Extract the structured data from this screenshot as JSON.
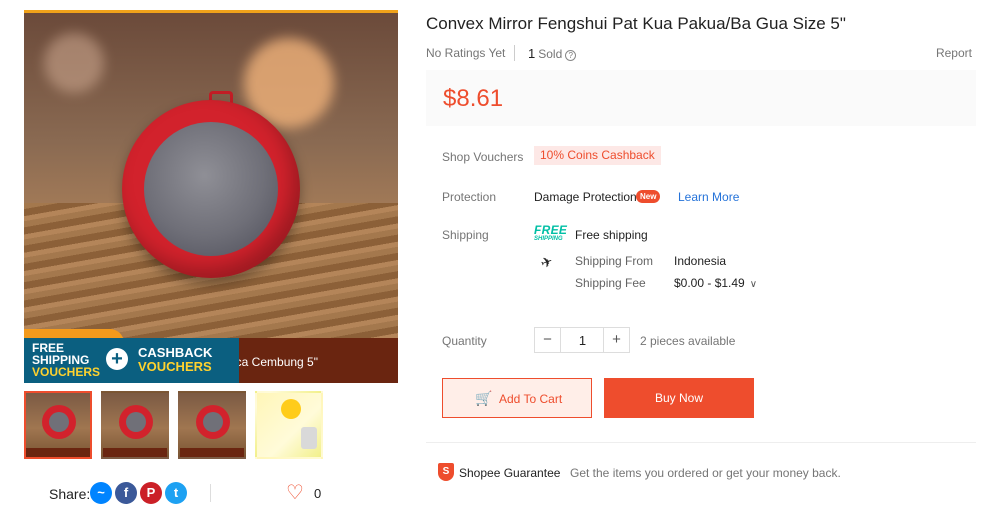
{
  "gallery": {
    "main_caption": "aca Cembung 5\"",
    "voucher": {
      "line1": "FREE",
      "line2": "SHIPPING",
      "line3": "VOUCHERS",
      "plus": "+",
      "line4": "CASHBACK",
      "line5": "VOUCHERS"
    },
    "thumbnail_count": 4
  },
  "share": {
    "label": "Share:",
    "icons": [
      "messenger-icon",
      "facebook-icon",
      "pinterest-icon",
      "twitter-icon"
    ],
    "like_count": "0"
  },
  "product": {
    "title": "Convex Mirror Fengshui Pat Kua Pakua/Ba Gua Size 5\"",
    "ratings": "No Ratings Yet",
    "sold_count": "1",
    "sold_label": "Sold",
    "report": "Report",
    "price": "$8.61"
  },
  "details": {
    "vouchers_label": "Shop Vouchers",
    "vouchers_value": "10% Coins Cashback",
    "protection_label": "Protection",
    "protection_value": "Damage Protection",
    "new_badge": "New",
    "learn_more": "Learn More",
    "shipping_label": "Shipping",
    "free_logo_top": "FREE",
    "free_logo_bottom": "SHIPPING",
    "free_shipping": "Free shipping",
    "ship_from_label": "Shipping From",
    "ship_from_value": "Indonesia",
    "ship_fee_label": "Shipping Fee",
    "ship_fee_value": "$0.00 - $1.49"
  },
  "quantity": {
    "label": "Quantity",
    "minus": "−",
    "value": "1",
    "plus": "+",
    "available": "2 pieces available"
  },
  "actions": {
    "add_to_cart": "Add To Cart",
    "buy_now": "Buy Now"
  },
  "guarantee": {
    "title": "Shopee Guarantee",
    "text": "Get the items you ordered or get your money back."
  },
  "colors": {
    "brand": "#ee4d2d",
    "free_shipping": "#00bfa5",
    "link": "#2573d9"
  }
}
